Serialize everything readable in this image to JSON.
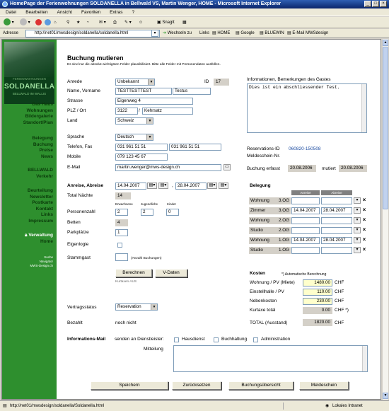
{
  "window": {
    "title": "HomePage der Ferienwohnungen SOLDANELLA in Bellwald VS, Martin Wenger, HOME - Microsoft Internet Explorer"
  },
  "menu": [
    "Datei",
    "Bearbeiten",
    "Ansicht",
    "Favoriten",
    "Extras",
    "?"
  ],
  "toolbar": {
    "snagit": "SnagIt"
  },
  "address": {
    "label": "Adresse",
    "url": "http://net01/mwsdesign/soldanella/soldanella.html",
    "go": "Wechseln zu",
    "links_label": "Links",
    "links": [
      "HOME",
      "Google",
      "BLUEWIN",
      "E-Mail MWSdesign"
    ]
  },
  "logo": {
    "top": "FERIENWOHNUNGEN",
    "name": "SOLDANELLA",
    "sub": "BELLWALD IM WALLIS"
  },
  "nav": {
    "group1": [
      "Das Haus",
      "Wohnungen",
      "Bildergalerie",
      "Standort/Plan"
    ],
    "group2": [
      "Belegung",
      "Buchung",
      "Preise",
      "News"
    ],
    "group3": [
      "BELLWALD",
      "Verkehr"
    ],
    "group4": [
      "Beurteilung",
      "Newsletter",
      "Postkarte",
      "Kontakt",
      "Links",
      "Impressum"
    ],
    "group5": [
      "Verwaltung",
      "Home"
    ],
    "small": [
      "Suche",
      "Navigator",
      "MWS-Design.ch"
    ]
  },
  "form": {
    "title": "Buchung mutieren",
    "hint": "Es sind nur die absolut wichtigsten Felder plausibilisiert. Bitte alle Felder mit Personendaten ausfüllen.",
    "labels": {
      "anrede": "Anrede",
      "name": "Name, Vorname",
      "strasse": "Strasse",
      "plz": "PLZ / Ort",
      "land": "Land",
      "sprache": "Sprache",
      "telefon": "Telefon, Fax",
      "mobile": "Mobile",
      "email": "E-Mail",
      "id": "ID",
      "info": "Informationen, Bemerkungen des Gastes",
      "res_id": "Reservations-ID",
      "meldeschein": "Meldeschein-Nr.",
      "erfasst": "Buchung erfasst",
      "mutiert": "mutiert",
      "anreise": "Anreise, Abreise",
      "naechte": "Total Nächte",
      "personen": "Personenzahl",
      "erwachsene": "Erwachsene",
      "jugendliche": "Jugendliche",
      "kinder": "Kinder",
      "betten": "Betten",
      "parkplaetze": "Parkplätze",
      "eigenlogie": "Eigenlogie",
      "stammgast": "Stammgast",
      "anzahl_buchungen": "(Anzahl Buchungen)",
      "kurtaxen": "Kurtaxen AUS",
      "vertragsstatus": "Vertragsstatus",
      "bezahlt": "Bezahlt",
      "informationsmail": "Informations-Mail",
      "dienstleister": "senden an Dienstleister:",
      "hausdienst": "Hausdienst",
      "buchhaltung": "Buchhaltung",
      "administration": "Administration",
      "mitteilung": "Mitteilung",
      "belegung": "Belegung",
      "anreise_col": "Anreise",
      "abreise_col": "Abreise",
      "kosten": "Kosten",
      "auto": "*) Automatische Berechnung",
      "wohnung_pv": "Wohnung / PV (Miete)",
      "einstellhalle": "Einstellhalle / PV",
      "nebenkosten": "Nebenkosten",
      "kurtaxe": "Kurtaxe total",
      "total": "TOTAL (Ausstand)",
      "chf": "CHF",
      "chf_star": "CHF *)"
    },
    "values": {
      "anrede": "Unbekannt",
      "id": "17",
      "name": "TESTTESTTEST",
      "vorname": "Testus",
      "strasse": "Eigenweg 4",
      "plz": "3122",
      "ort": "Kehrsatz",
      "land": "Schweiz",
      "sprache": "Deutsch",
      "telefon": "031 961 51 51",
      "fax": "031 961 51 51",
      "mobile": "079 123 45 67",
      "email": "martin.wenger@mws-design.ch",
      "info": "Dies ist ein abschliessender Test.",
      "res_id": "060820-150508",
      "erfasst": "20.08.2006",
      "mutiert": "20.08.2006",
      "anreise": "14.04.2007",
      "abreise": "28.04.2007",
      "naechte": "14",
      "erwachsene": "2",
      "jugendliche": "2",
      "kinder": "0",
      "betten": "4",
      "parkplaetze": "1",
      "stammgast": "",
      "vertragsstatus": "Reservation",
      "bezahlt": "noch nicht",
      "wohnung_pv": "1480.00",
      "einstellhalle": "110.00",
      "nebenkosten": "230.00",
      "kurtaxe": "0.00",
      "total": "1820.00"
    },
    "belegung": [
      {
        "label": "Wohnung",
        "floor": "3.OG",
        "anreise": "",
        "abreise": ""
      },
      {
        "label": "Zimmer",
        "floor": "3.OG",
        "anreise": "14.04.2007",
        "abreise": "28.04.2007"
      },
      {
        "label": "Wohnung",
        "floor": "2.OG",
        "anreise": "",
        "abreise": ""
      },
      {
        "label": "Studio",
        "floor": "2.OG",
        "anreise": "",
        "abreise": ""
      },
      {
        "label": "Wohnung",
        "floor": "1.OG",
        "anreise": "14.04.2007",
        "abreise": "28.04.2007"
      },
      {
        "label": "Studio",
        "floor": "1.OG",
        "anreise": "",
        "abreise": ""
      }
    ],
    "buttons": {
      "berechnen": "Berechnen",
      "vdaten": "V-Daten",
      "speichern": "Speichern",
      "zuruecksetzen": "Zurücksetzen",
      "uebersicht": "Buchungsübersicht",
      "meldeschein": "Meldeschein"
    }
  },
  "status": {
    "url": "http://net01/mwsdesign/soldanella/Soldanella.html",
    "zone": "Lokales Intranet"
  }
}
